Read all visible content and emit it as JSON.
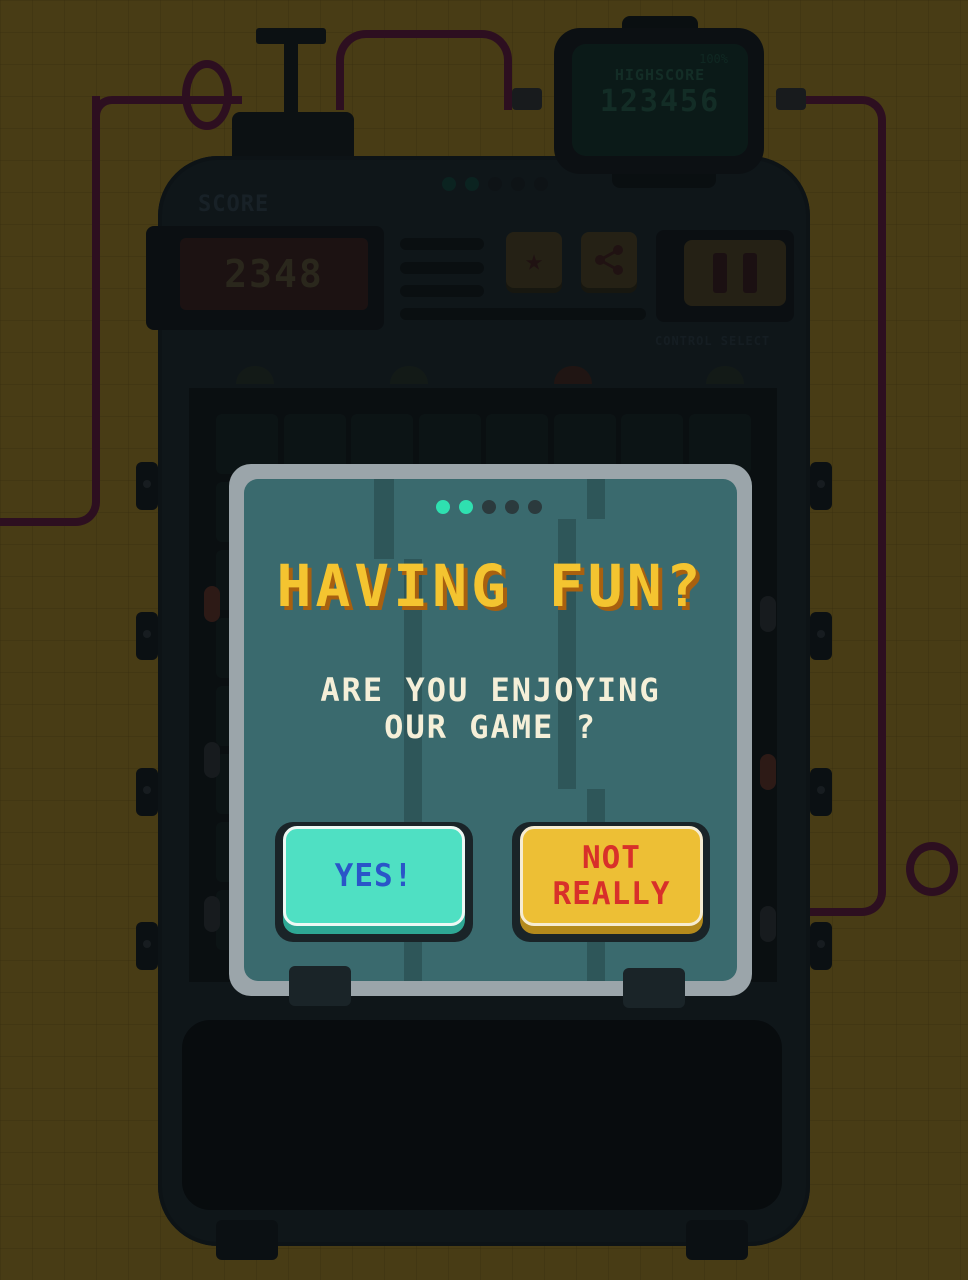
{
  "hud": {
    "score_label": "SCORE",
    "score_value": "2348",
    "control_select_label": "CONTROL SELECT",
    "star_icon": "★"
  },
  "highscore": {
    "battery": "100%",
    "label": "HIGHSCORE",
    "value": "123456"
  },
  "device_page_dots": {
    "count": 5,
    "active": 2
  },
  "dialog": {
    "title": "HAVING FUN?",
    "message": "ARE YOU ENJOYING\nOUR GAME ?",
    "yes_label": "YES!",
    "no_label": "NOT\nREALLY",
    "page_dots": {
      "count": 5,
      "active": 2
    }
  },
  "colors": {
    "background": "#e8b321",
    "title": "#f4c430",
    "yes_button": "#4fe0c3",
    "no_button": "#edbf35",
    "wire": "#8a1448"
  }
}
